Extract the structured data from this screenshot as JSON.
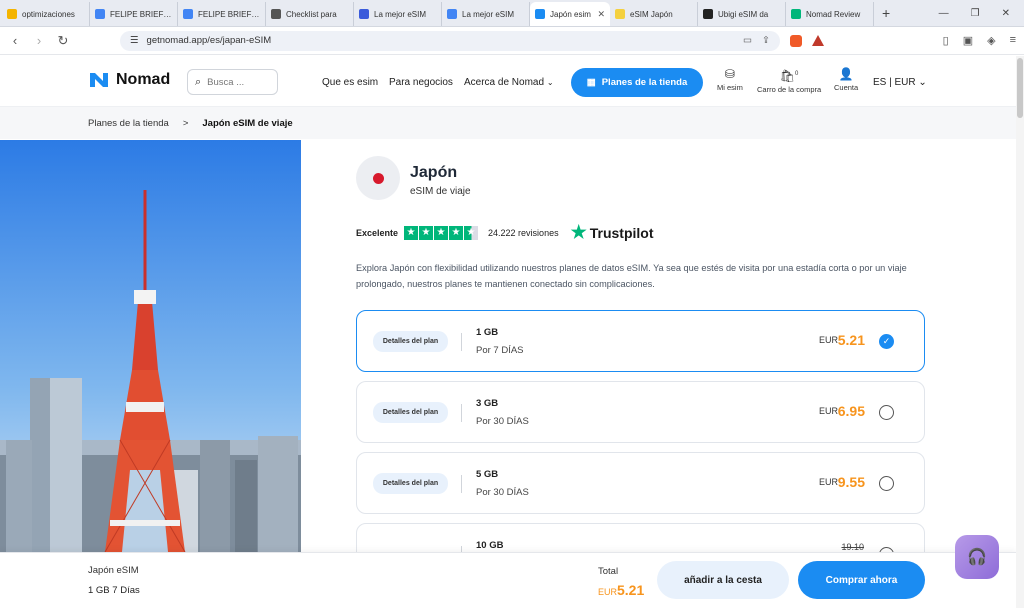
{
  "browser": {
    "tabs": [
      {
        "title": "optimizaciones",
        "color": "#f4b400"
      },
      {
        "title": "FELIPE BRIEFS C",
        "color": "#4285f4"
      },
      {
        "title": "FELIPE BRIEFS C",
        "color": "#4285f4"
      },
      {
        "title": "Checklist para",
        "color": "#555555"
      },
      {
        "title": "La mejor eSIM",
        "color": "#3b5bdb"
      },
      {
        "title": "La mejor eSIM",
        "color": "#4285f4"
      },
      {
        "title": "Japón esim",
        "color": "#1b8cf2",
        "active": true
      },
      {
        "title": "eSIM Japón",
        "color": "#f4d03f"
      },
      {
        "title": "Ubigi eSIM da",
        "color": "#222222"
      },
      {
        "title": "Nomad Review",
        "color": "#00b67a"
      }
    ],
    "new_tab": "+",
    "url": "getnomad.app/es/japan-eSIM",
    "brave_count": "1"
  },
  "header": {
    "logo_text": "Nomad",
    "search_placeholder": "Busca ...",
    "nav": [
      "Que es esim",
      "Para negocios",
      "Acerca de Nomad"
    ],
    "store_button": "Planes de la tienda",
    "my_esim": "Mi esim",
    "cart": "Carro de la compra",
    "cart_count": "0",
    "account": "Cuenta",
    "lang": "ES | EUR"
  },
  "breadcrumb": {
    "parent": "Planes de la tienda",
    "separator": ">",
    "current": "Japón eSIM de viaje"
  },
  "product": {
    "country": "Japón",
    "subtitle": "eSIM de viaje",
    "trustpilot_label": "Excelente",
    "trustpilot_rating": 4.5,
    "reviews": "24.222 revisiones",
    "trustpilot_brand": "Trustpilot",
    "description": "Explora Japón con flexibilidad utilizando nuestros planes de datos eSIM. Ya sea que estés de visita por una estadía corta o por un viaje prolongado, nuestros planes te mantienen conectado sin complicaciones."
  },
  "plans": [
    {
      "details": "Detalles del plan",
      "data": "1 GB",
      "days": "Por 7 DÍAS",
      "currency": "EUR",
      "price": "5.21",
      "selected": true
    },
    {
      "details": "Detalles del plan",
      "data": "3 GB",
      "days": "Por 30 DÍAS",
      "currency": "EUR",
      "price": "6.95",
      "selected": false
    },
    {
      "details": "Detalles del plan",
      "data": "5 GB",
      "days": "Por 30 DÍAS",
      "currency": "EUR",
      "price": "9.55",
      "selected": false
    },
    {
      "details": "",
      "data": "10 GB",
      "days": "",
      "currency": "",
      "price": "",
      "old_price": "19.10",
      "selected": false
    }
  ],
  "footer_bar": {
    "product": "Japón eSIM",
    "plan": "1 GB 7 Días",
    "total_label": "Total",
    "currency": "EUR",
    "price": "5.21",
    "add_to_cart": "añadir a la cesta",
    "buy_now": "Comprar ahora"
  },
  "colors": {
    "accent": "#1b8cf2",
    "price": "#f7941d",
    "trustpilot": "#00b67a"
  }
}
